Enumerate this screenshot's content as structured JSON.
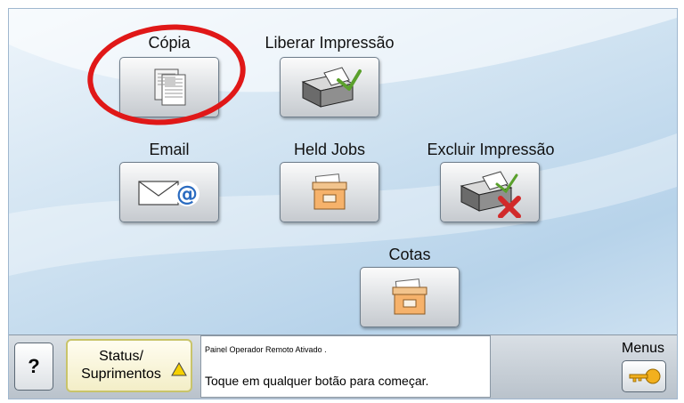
{
  "tiles": {
    "copia": {
      "label": "Cópia",
      "icon": "copy-document-icon"
    },
    "liberar": {
      "label": "Liberar Impressão",
      "icon": "printer-release-icon"
    },
    "email": {
      "label": "Email",
      "icon": "email-at-icon"
    },
    "held_jobs": {
      "label": "Held Jobs",
      "icon": "file-box-icon"
    },
    "excluir": {
      "label": "Excluir Impressão",
      "icon": "printer-delete-icon"
    },
    "cotas": {
      "label": "Cotas",
      "icon": "file-box-icon"
    }
  },
  "highlight": {
    "color": "#e01818",
    "target": "copia"
  },
  "bottom_bar": {
    "help_label": "?",
    "status_label": "Status/\nSuprimentos",
    "status_icon": "warning-triangle-icon",
    "message_line1": "Painel Operador Remoto Ativado .",
    "message_line2": "Toque em qualquer botão para começar.",
    "menus_label": "Menus",
    "menus_icon": "key-icon"
  }
}
